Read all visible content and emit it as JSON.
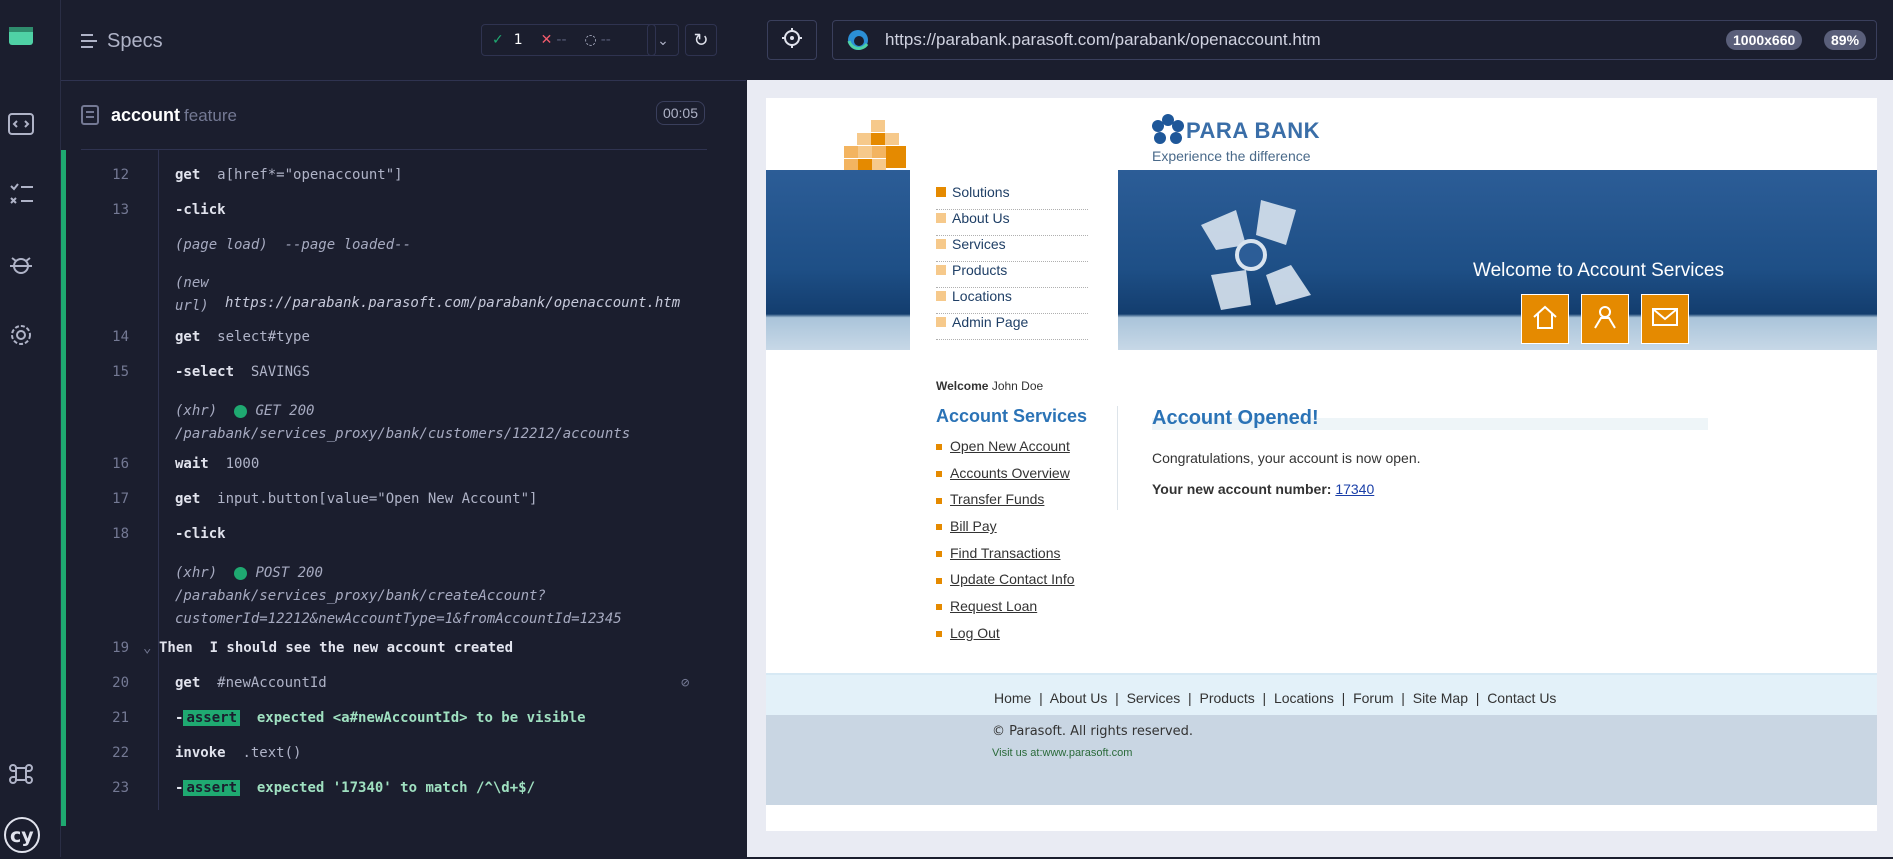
{
  "specs": {
    "title": "Specs",
    "passed": "1",
    "failed": "--",
    "pending": "--",
    "feature_name": "account",
    "feature_kind": "feature",
    "duration": "00:05"
  },
  "log": [
    {
      "n": "12",
      "cmd": "get",
      "arg": "a[href*=\"openaccount\"]"
    },
    {
      "n": "13",
      "cmd": "-click",
      "arg": ""
    },
    {
      "n": "",
      "italic": "(page load)",
      "arg": "--page loaded--"
    },
    {
      "n": "",
      "italic": "(new url)",
      "arg": "https://parabank.parasoft.com/parabank/openaccount.htm"
    },
    {
      "n": "14",
      "cmd": "get",
      "arg": "select#type"
    },
    {
      "n": "15",
      "cmd": "-select",
      "arg": "SAVINGS"
    },
    {
      "n": "",
      "italic": "(xhr)",
      "arg": "GET 200 /parabank/services_proxy/bank/customers/12212/accounts"
    },
    {
      "n": "16",
      "cmd": "wait",
      "arg": "1000"
    },
    {
      "n": "17",
      "cmd": "get",
      "arg": "input.button[value=\"Open New Account\"]"
    },
    {
      "n": "18",
      "cmd": "-click",
      "arg": ""
    },
    {
      "n": "",
      "italic": "(xhr)",
      "arg": "POST 200 /parabank/services_proxy/bank/createAccount? customerId=12212&newAccountType=1&fromAccountId=12345"
    },
    {
      "n": "19",
      "cmd": "Then",
      "arg": "I should see the new account created"
    },
    {
      "n": "20",
      "cmd": "get",
      "arg": "#newAccountId"
    },
    {
      "n": "21",
      "cmd": "-assert",
      "arg": "expected <a#newAccountId> to be visible"
    },
    {
      "n": "22",
      "cmd": "invoke",
      "arg": ".text()"
    },
    {
      "n": "23",
      "cmd": "-assert",
      "arg": "expected '17340' to match /^\\d+$/"
    }
  ],
  "aut": {
    "url": "https://parabank.parasoft.com/parabank/openaccount.htm",
    "viewport": "1000x660",
    "zoom": "89%"
  },
  "parabank": {
    "brand": "PARA BANK",
    "tagline": "Experience the difference",
    "topnav": [
      "Solutions",
      "About Us",
      "Services",
      "Products",
      "Locations",
      "Admin Page"
    ],
    "banner": "Welcome to Account Services",
    "welcome_label": "Welcome",
    "welcome_user": "John Doe",
    "account_services_title": "Account Services",
    "account_links": [
      "Open New Account",
      "Accounts Overview",
      "Transfer Funds",
      "Bill Pay",
      "Find Transactions",
      "Update Contact Info",
      "Request Loan",
      "Log Out"
    ],
    "opened_title": "Account Opened!",
    "congrats": "Congratulations, your account is now open.",
    "new_account_label": "Your new account number:",
    "new_account_number": "17340",
    "footer_links": [
      "Home",
      "About Us",
      "Services",
      "Products",
      "Locations",
      "Forum",
      "Site Map",
      "Contact Us"
    ],
    "copyright": "© Parasoft. All rights reserved.",
    "visit": "Visit us at:www.parasoft.com"
  },
  "colors": {
    "accent_green": "#1fa971",
    "parabank_blue": "#1e5799",
    "orange": "#e58a00"
  }
}
